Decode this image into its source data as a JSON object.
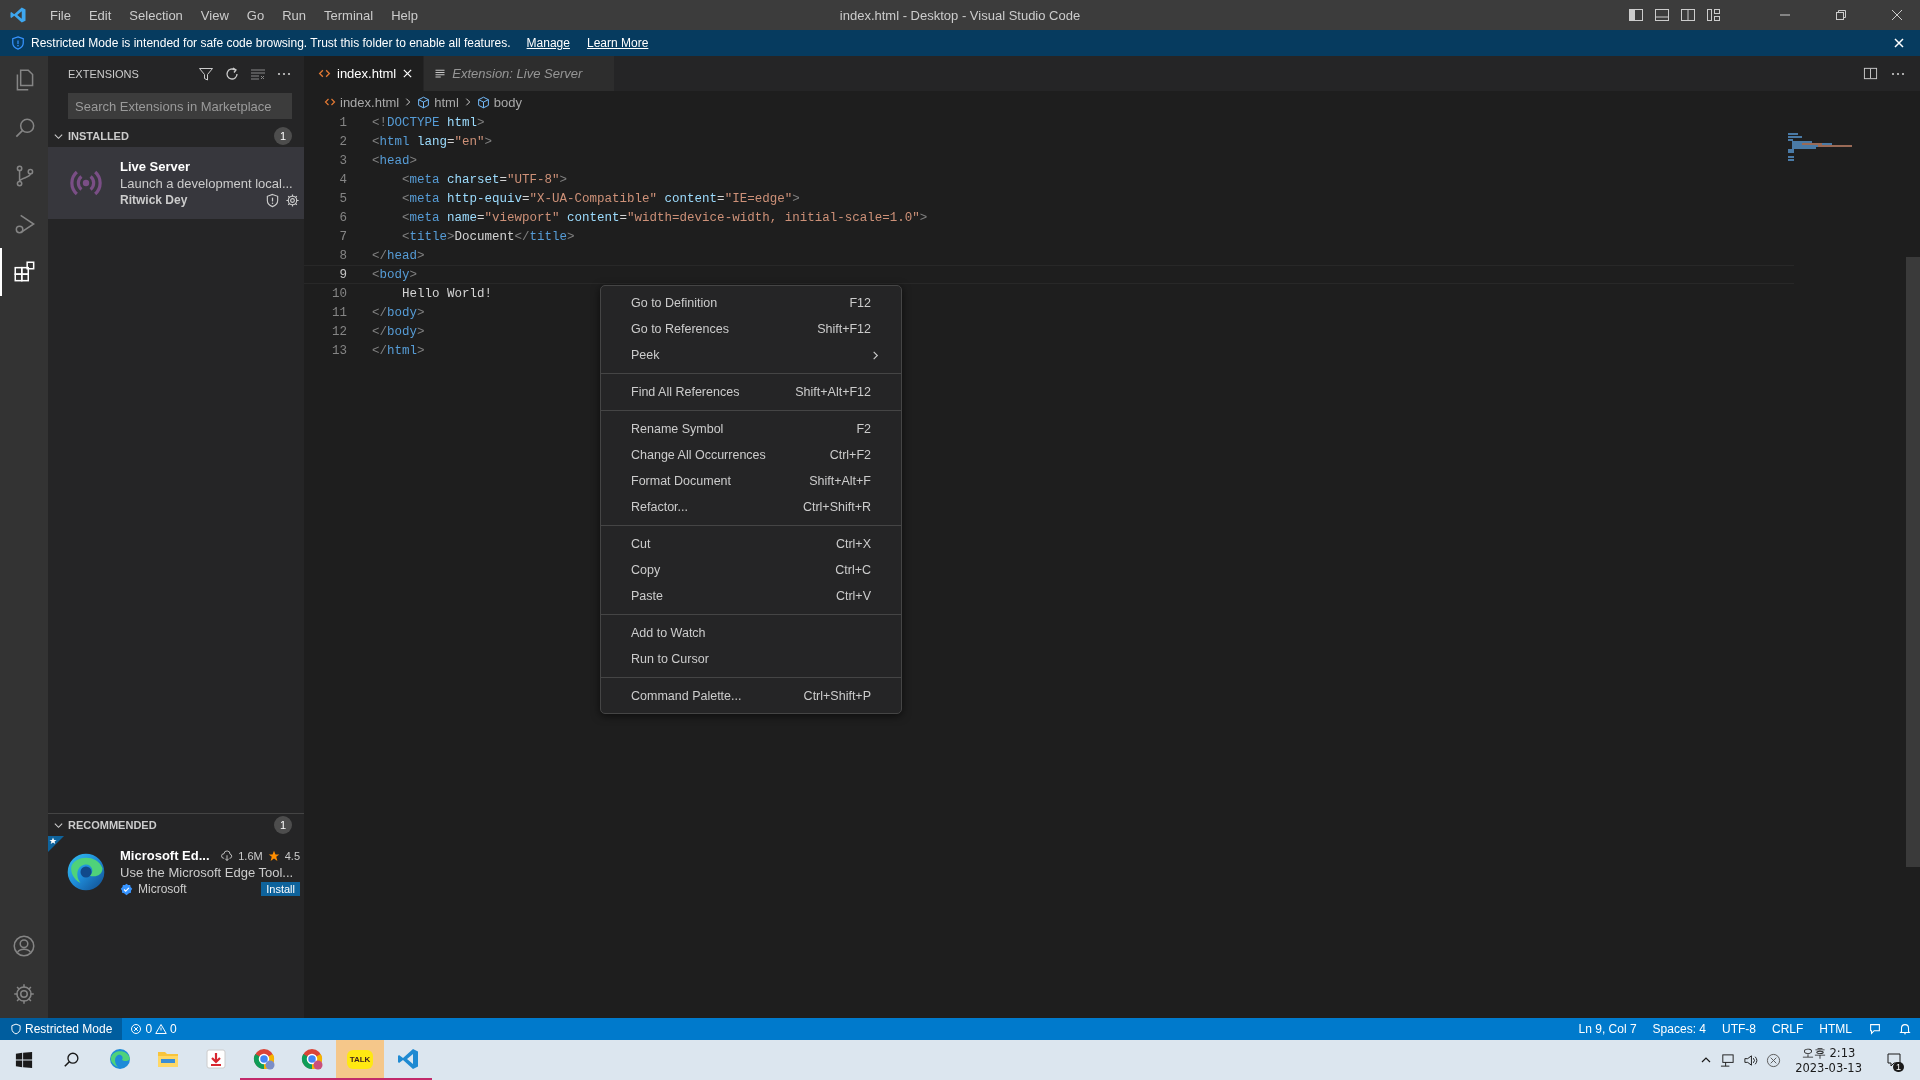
{
  "window": {
    "title": "index.html - Desktop - Visual Studio Code"
  },
  "menu": [
    "File",
    "Edit",
    "Selection",
    "View",
    "Go",
    "Run",
    "Terminal",
    "Help"
  ],
  "banner": {
    "text": "Restricted Mode is intended for safe code browsing. Trust this folder to enable all features.",
    "links": [
      "Manage",
      "Learn More"
    ]
  },
  "activity_bar": [
    {
      "kind": "files",
      "selected": false
    },
    {
      "kind": "search",
      "selected": false
    },
    {
      "kind": "source-control",
      "selected": false
    },
    {
      "kind": "run",
      "selected": false
    },
    {
      "kind": "extensions",
      "selected": true
    }
  ],
  "sidebar": {
    "title": "EXTENSIONS",
    "search": {
      "placeholder": "Search Extensions in Marketplace"
    },
    "installed": {
      "title": "INSTALLED",
      "count": "1",
      "items": [
        {
          "name": "Live Server",
          "description": "Launch a development local...",
          "publisher": "Ritwick Dey",
          "selected": true
        }
      ]
    },
    "recommended": {
      "title": "RECOMMENDED",
      "count": "1",
      "items": [
        {
          "name": "Microsoft Ed...",
          "downloads": "1.6M",
          "rating": "4.5",
          "description": "Use the Microsoft Edge Tool...",
          "publisher": "Microsoft",
          "button": "Install"
        }
      ]
    }
  },
  "tabs": [
    {
      "label": "index.html",
      "selected": true,
      "preview": false
    },
    {
      "label": "Extension: Live Server",
      "selected": false,
      "preview": true
    }
  ],
  "breadcrumbs": [
    "index.html",
    "html",
    "body"
  ],
  "code": [
    {
      "number": "1",
      "current": false,
      "tokens": [
        {
          "kind": "punct",
          "text": "<!"
        },
        {
          "kind": "tag",
          "text": "DOCTYPE"
        },
        {
          "kind": "attr",
          "text": " html"
        },
        {
          "kind": "punct",
          "text": ">"
        }
      ]
    },
    {
      "number": "2",
      "current": false,
      "tokens": [
        {
          "kind": "punct",
          "text": "<"
        },
        {
          "kind": "tag",
          "text": "html"
        },
        {
          "kind": "attr",
          "text": " lang"
        },
        {
          "kind": "text",
          "text": "="
        },
        {
          "kind": "string",
          "text": "\"en\""
        },
        {
          "kind": "punct",
          "text": ">"
        }
      ]
    },
    {
      "number": "3",
      "current": false,
      "tokens": [
        {
          "kind": "punct",
          "text": "<"
        },
        {
          "kind": "tag",
          "text": "head"
        },
        {
          "kind": "punct",
          "text": ">"
        }
      ]
    },
    {
      "number": "4",
      "current": false,
      "tokens": [
        {
          "kind": "punct",
          "text": "    <"
        },
        {
          "kind": "tag",
          "text": "meta"
        },
        {
          "kind": "attr",
          "text": " charset"
        },
        {
          "kind": "text",
          "text": "="
        },
        {
          "kind": "string",
          "text": "\"UTF-8\""
        },
        {
          "kind": "punct",
          "text": ">"
        }
      ]
    },
    {
      "number": "5",
      "current": false,
      "tokens": [
        {
          "kind": "punct",
          "text": "    <"
        },
        {
          "kind": "tag",
          "text": "meta"
        },
        {
          "kind": "attr",
          "text": " http-equiv"
        },
        {
          "kind": "text",
          "text": "="
        },
        {
          "kind": "string",
          "text": "\"X-UA-Compatible\""
        },
        {
          "kind": "attr",
          "text": " content"
        },
        {
          "kind": "text",
          "text": "="
        },
        {
          "kind": "string",
          "text": "\"IE=edge\""
        },
        {
          "kind": "punct",
          "text": ">"
        }
      ]
    },
    {
      "number": "6",
      "current": false,
      "tokens": [
        {
          "kind": "punct",
          "text": "    <"
        },
        {
          "kind": "tag",
          "text": "meta"
        },
        {
          "kind": "attr",
          "text": " name"
        },
        {
          "kind": "text",
          "text": "="
        },
        {
          "kind": "string",
          "text": "\"viewport\""
        },
        {
          "kind": "attr",
          "text": " content"
        },
        {
          "kind": "text",
          "text": "="
        },
        {
          "kind": "string",
          "text": "\"width=device-width, initial-scale=1.0\""
        },
        {
          "kind": "punct",
          "text": ">"
        }
      ]
    },
    {
      "number": "7",
      "current": false,
      "tokens": [
        {
          "kind": "punct",
          "text": "    <"
        },
        {
          "kind": "tag",
          "text": "title"
        },
        {
          "kind": "punct",
          "text": ">"
        },
        {
          "kind": "text",
          "text": "Document"
        },
        {
          "kind": "punct",
          "text": "</"
        },
        {
          "kind": "tag",
          "text": "title"
        },
        {
          "kind": "punct",
          "text": ">"
        }
      ]
    },
    {
      "number": "8",
      "current": false,
      "tokens": [
        {
          "kind": "punct",
          "text": "</"
        },
        {
          "kind": "tag",
          "text": "head"
        },
        {
          "kind": "punct",
          "text": ">"
        }
      ]
    },
    {
      "number": "9",
      "current": true,
      "tokens": [
        {
          "kind": "punct",
          "text": "<"
        },
        {
          "kind": "tag",
          "text": "body"
        },
        {
          "kind": "punct",
          "text": ">"
        }
      ]
    },
    {
      "number": "10",
      "current": false,
      "tokens": [
        {
          "kind": "text",
          "text": "    Hello World!"
        }
      ]
    },
    {
      "number": "11",
      "current": false,
      "tokens": [
        {
          "kind": "punct",
          "text": "</"
        },
        {
          "kind": "tag",
          "text": "body"
        },
        {
          "kind": "punct",
          "text": ">"
        }
      ]
    },
    {
      "number": "12",
      "current": false,
      "tokens": [
        {
          "kind": "punct",
          "text": "</"
        },
        {
          "kind": "tag",
          "text": "body"
        },
        {
          "kind": "punct",
          "text": ">"
        }
      ]
    },
    {
      "number": "13",
      "current": false,
      "tokens": [
        {
          "kind": "punct",
          "text": "</"
        },
        {
          "kind": "tag",
          "text": "html"
        },
        {
          "kind": "punct",
          "text": ">"
        }
      ]
    }
  ],
  "context_menu": [
    [
      {
        "label": "Go to Definition",
        "shortcut": "F12",
        "submenu": false
      },
      {
        "label": "Go to References",
        "shortcut": "Shift+F12",
        "submenu": false
      },
      {
        "label": "Peek",
        "submenu": true
      }
    ],
    [
      {
        "label": "Find All References",
        "shortcut": "Shift+Alt+F12",
        "submenu": false
      }
    ],
    [
      {
        "label": "Rename Symbol",
        "shortcut": "F2",
        "submenu": false
      },
      {
        "label": "Change All Occurrences",
        "shortcut": "Ctrl+F2",
        "submenu": false
      },
      {
        "label": "Format Document",
        "shortcut": "Shift+Alt+F",
        "submenu": false
      },
      {
        "label": "Refactor...",
        "shortcut": "Ctrl+Shift+R",
        "submenu": false
      }
    ],
    [
      {
        "label": "Cut",
        "shortcut": "Ctrl+X",
        "submenu": false
      },
      {
        "label": "Copy",
        "shortcut": "Ctrl+C",
        "submenu": false
      },
      {
        "label": "Paste",
        "shortcut": "Ctrl+V",
        "submenu": false
      }
    ],
    [
      {
        "label": "Add to Watch",
        "submenu": false
      },
      {
        "label": "Run to Cursor",
        "submenu": false
      }
    ],
    [
      {
        "label": "Command Palette...",
        "shortcut": "Ctrl+Shift+P",
        "submenu": false
      }
    ]
  ],
  "status_bar": {
    "left": {
      "mode": "Restricted Mode",
      "errors": "0",
      "warnings": "0"
    },
    "right": [
      "Ln 9, Col 7",
      "Spaces: 4",
      "UTF-8",
      "CRLF",
      "HTML"
    ]
  },
  "taskbar": {
    "apps": [
      {
        "kind": "edge",
        "running": false
      },
      {
        "kind": "folder",
        "running": false
      },
      {
        "kind": "download",
        "running": false
      },
      {
        "kind": "chrome",
        "running": true
      },
      {
        "kind": "chrome2",
        "running": true
      },
      {
        "kind": "talk",
        "label": "TALK",
        "running": true
      },
      {
        "kind": "vscode",
        "running": true
      }
    ],
    "clock": {
      "time": "오후 2:13",
      "date": "2023-03-13"
    },
    "notifications": "1"
  }
}
